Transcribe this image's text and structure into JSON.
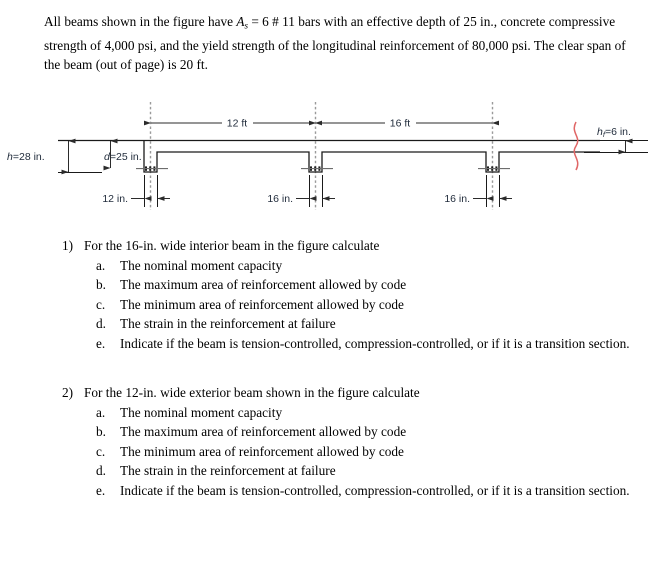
{
  "intro": {
    "line_1_a": "All beams shown in the figure have ",
    "As_symbol": "A",
    "As_sub": "s",
    "line_1_b": " = 6 # 11 bars with an effective depth of 25 in.,",
    "line_2": "concrete compressive strength of 4,000 psi, and the yield strength of the longitudinal",
    "line_3": "reinforcement of 80,000 psi. The clear span of the beam (out of page) is 20 ft."
  },
  "figure": {
    "title": "reinforced-concrete-t-beam-floor-system-section",
    "span_dim_left": "12 ft",
    "span_dim_right": "16 ft",
    "height_label_var": "h",
    "height_label_value": "=28 in.",
    "depth_label_var": "d",
    "depth_label_value": "=25 in.",
    "flange_label_var": "h",
    "flange_label_sub": "f",
    "flange_label_value": "=6 in.",
    "width_label_1": "12 in.",
    "width_label_2": "16 in.",
    "width_label_3": "16 in.",
    "colors": {
      "line": "#1a1a1a",
      "dimension": "#2b2b2b",
      "centerline": "#8c8c8c",
      "break_line": "#e06666",
      "label_text": "#1f2a3a"
    }
  },
  "questions": [
    {
      "number": "1)",
      "heading": "For the 16-in. wide interior beam in the figure calculate",
      "items": [
        {
          "letter": "a.",
          "text": "The nominal moment capacity"
        },
        {
          "letter": "b.",
          "text": "The maximum area of reinforcement allowed by code"
        },
        {
          "letter": "c.",
          "text": "The minimum area of reinforcement allowed by code"
        },
        {
          "letter": "d.",
          "text": "The strain in the reinforcement at failure"
        },
        {
          "letter": "e.",
          "text": "Indicate if the beam is tension-controlled, compression-controlled, or if it is a transition section."
        }
      ]
    },
    {
      "number": "2)",
      "heading": "For the 12-in. wide exterior beam shown in the figure calculate",
      "items": [
        {
          "letter": "a.",
          "text": "The nominal moment capacity"
        },
        {
          "letter": "b.",
          "text": "The maximum area of reinforcement allowed by code"
        },
        {
          "letter": "c.",
          "text": "The minimum area of reinforcement allowed by code"
        },
        {
          "letter": "d.",
          "text": "The strain in the reinforcement at failure"
        },
        {
          "letter": "e.",
          "text": "Indicate if the beam is tension-controlled, compression-controlled, or if it is a transition section."
        }
      ]
    }
  ]
}
